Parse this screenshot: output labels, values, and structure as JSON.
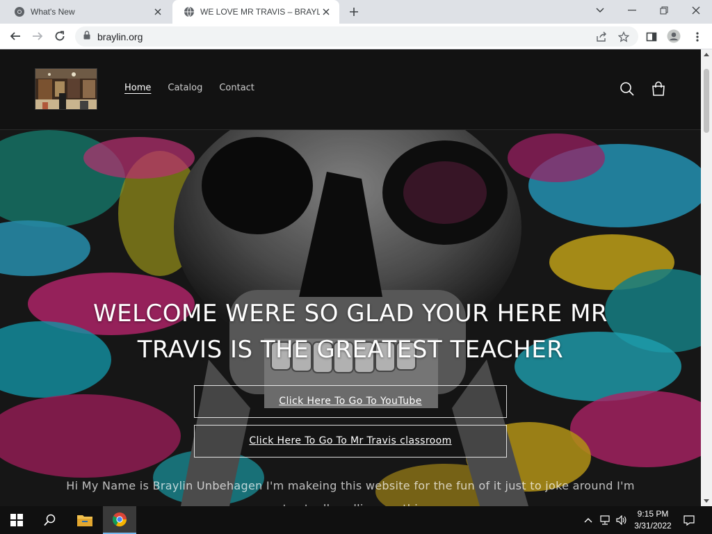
{
  "browser": {
    "tabs": [
      {
        "title": "What's New",
        "active": false
      },
      {
        "title": "WE LOVE MR TRAVIS – BRAYLIN.ORG",
        "active": true
      }
    ],
    "url": "braylin.org"
  },
  "site": {
    "nav": [
      {
        "label": "Home",
        "current": true
      },
      {
        "label": "Catalog",
        "current": false
      },
      {
        "label": "Contact",
        "current": false
      }
    ],
    "hero": {
      "title": "WELCOME WERE SO GLAD YOUR HERE MR TRAVIS IS THE GREATEST TEACHER",
      "button1": "Click Here To Go To YouTube",
      "button2": "Click Here To Go To Mr Travis classroom",
      "text": "Hi My Name is Braylin Unbehagen I'm makeing this website for the fun of it just to joke around I'm not actually selling anything"
    }
  },
  "taskbar": {
    "time": "9:15 PM",
    "date": "3/31/2022"
  },
  "colors": {
    "header_bg": "#121212",
    "tabstrip_bg": "#dee1e6",
    "taskbar_bg": "#101010"
  }
}
